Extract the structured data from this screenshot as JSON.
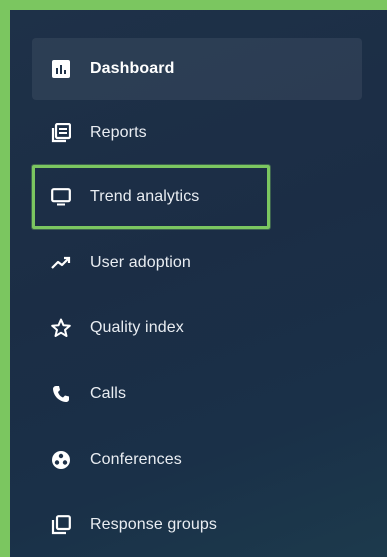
{
  "sidebar": {
    "items": [
      {
        "label": "Dashboard",
        "icon": "bar-chart-icon",
        "active": true
      },
      {
        "label": "Reports",
        "icon": "reports-icon"
      },
      {
        "label": "Trend analytics",
        "icon": "monitor-icon",
        "highlighted": true
      },
      {
        "label": "User adoption",
        "icon": "trend-line-icon"
      },
      {
        "label": "Quality index",
        "icon": "star-icon"
      },
      {
        "label": "Calls",
        "icon": "phone-icon"
      },
      {
        "label": "Conferences",
        "icon": "conference-icon"
      },
      {
        "label": "Response groups",
        "icon": "response-groups-icon"
      }
    ]
  },
  "colors": {
    "highlight_border": "#7bc660",
    "sidebar_background": "#1d2f46",
    "text": "#e9edf2"
  }
}
